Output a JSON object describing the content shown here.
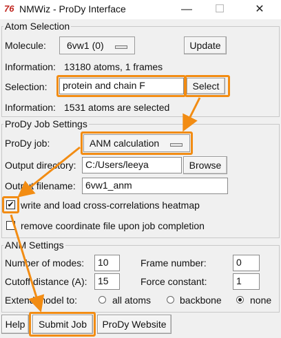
{
  "window": {
    "title": "NMWiz - ProDy Interface",
    "icon_text": "76",
    "controls": {
      "minimize": "—",
      "maximize": "☐",
      "close": "✕"
    }
  },
  "atom_selection": {
    "group_title": "Atom Selection",
    "molecule_label": "Molecule:",
    "molecule_value": "6vw1 (0)",
    "update_button": "Update",
    "info1_label": "Information:",
    "info1_value": "13180 atoms, 1 frames",
    "selection_label": "Selection:",
    "selection_value": "protein and chain F",
    "select_button": "Select",
    "info2_label": "Information:",
    "info2_value": "1531 atoms are selected"
  },
  "job_settings": {
    "group_title": "ProDy Job Settings",
    "job_label": "ProDy job:",
    "job_value": "ANM calculation",
    "outdir_label": "Output directory:",
    "outdir_value": "C:/Users/leeya",
    "browse_button": "Browse",
    "outfile_label": "Output filename:",
    "outfile_value": "6vw1_anm",
    "heatmap_label": "write and load cross-correlations heatmap",
    "heatmap_checked": true,
    "remove_label": "remove coordinate file upon job completion",
    "remove_checked": false
  },
  "anm_settings": {
    "group_title": "ANM Settings",
    "modes_label": "Number of modes:",
    "modes_value": "10",
    "frame_label": "Frame number:",
    "frame_value": "0",
    "cutoff_label": "Cutoff distance (A):",
    "cutoff_value": "15",
    "force_label": "Force constant:",
    "force_value": "1",
    "extend_label": "Extend model to:",
    "extend_options": [
      "all atoms",
      "backbone",
      "none"
    ],
    "extend_selected": "none"
  },
  "bottom_buttons": {
    "help": "Help",
    "submit": "Submit Job",
    "website": "ProDy Website"
  },
  "colors": {
    "highlight": "#f28c13",
    "background": "#f0f0f0"
  }
}
